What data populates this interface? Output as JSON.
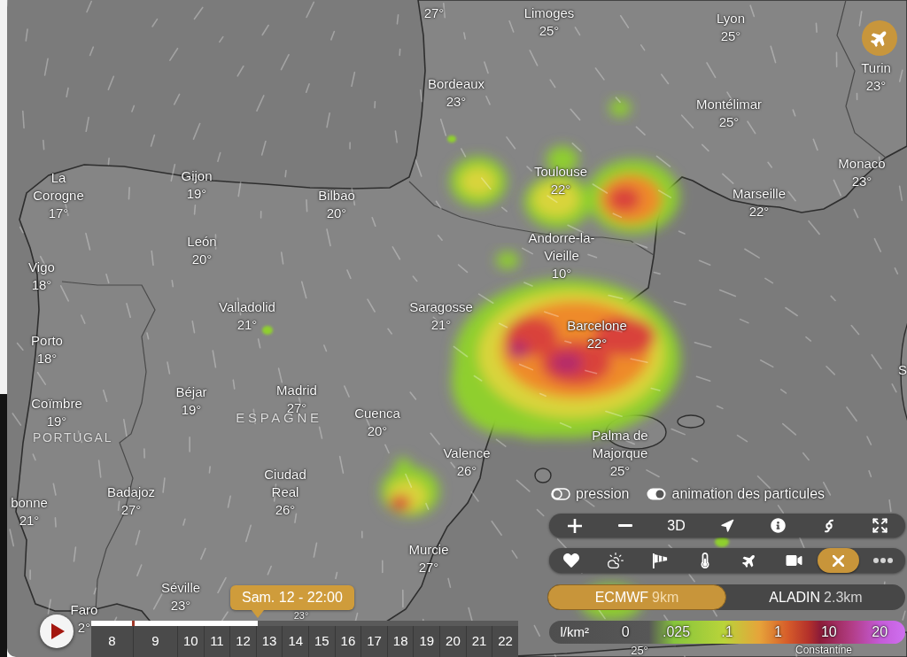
{
  "map": {
    "cities": [
      {
        "temp": "27°"
      },
      {
        "name": "Limoges",
        "temp": "25°"
      },
      {
        "name": "Lyon",
        "temp": "25°"
      },
      {
        "name": "Bordeaux",
        "temp": "23°"
      },
      {
        "name": "Turin",
        "temp": "23°"
      },
      {
        "name": "Montélimar",
        "temp": "25°"
      },
      {
        "name": "La Corogne",
        "temp": "17°"
      },
      {
        "name": "Gijon",
        "temp": "19°"
      },
      {
        "name": "Bilbao",
        "temp": "20°"
      },
      {
        "name": "Toulouse",
        "temp": "22°"
      },
      {
        "name": "Marseille",
        "temp": "22°"
      },
      {
        "name": "Monaco",
        "temp": "23°"
      },
      {
        "name": "Vigo",
        "temp": "18°"
      },
      {
        "name": "León",
        "temp": "20°"
      },
      {
        "name": "Andorre-la-Vieille",
        "temp": "10°"
      },
      {
        "name": "Porto",
        "temp": "18°"
      },
      {
        "name": "Valladolid",
        "temp": "21°"
      },
      {
        "name": "Saragosse",
        "temp": "21°"
      },
      {
        "name": "Barcelone",
        "temp": "22°"
      },
      {
        "name": "S"
      },
      {
        "name": "Coïmbre",
        "temp": "19°"
      },
      {
        "name": "Béjar",
        "temp": "19°"
      },
      {
        "name": "Madrid",
        "temp": "27°"
      },
      {
        "name": "Cuenca",
        "temp": "20°"
      },
      {
        "name": "bonne",
        "temp": "21°"
      },
      {
        "name": "Badajoz",
        "temp": "27°"
      },
      {
        "name": "Ciudad Real",
        "temp": "26°"
      },
      {
        "name": "Valence",
        "temp": "26°"
      },
      {
        "name": "Palma de Majorque",
        "temp": "25°"
      },
      {
        "name": "Murcie",
        "temp": "27°"
      },
      {
        "name": "Faro",
        "temp": "2°"
      },
      {
        "name": "Séville",
        "temp": "23°"
      },
      {
        "temp": "23°"
      },
      {
        "temp": "25°"
      },
      {
        "name": "Constantine"
      }
    ],
    "countries": [
      {
        "name": "ESPAGNE"
      },
      {
        "name": "PORTUGAL"
      }
    ]
  },
  "layer_toggles": [
    {
      "label": "pression",
      "on": false
    },
    {
      "label": "animation des particules",
      "on": true
    }
  ],
  "map_controls": [
    {
      "kind": "zoom_in"
    },
    {
      "kind": "zoom_out"
    },
    {
      "kind": "text",
      "label": "3D"
    },
    {
      "kind": "locate"
    },
    {
      "kind": "info"
    },
    {
      "kind": "hurricane"
    },
    {
      "kind": "fullscreen"
    }
  ],
  "layer_bar": [
    {
      "kind": "favorites"
    },
    {
      "kind": "clouds"
    },
    {
      "kind": "wind"
    },
    {
      "kind": "temperature"
    },
    {
      "kind": "airports"
    },
    {
      "kind": "webcams"
    },
    {
      "kind": "close"
    },
    {
      "kind": "more"
    }
  ],
  "models": [
    {
      "name": "ECMWF",
      "resolution": "9km",
      "selected": true
    },
    {
      "name": "ALADIN",
      "resolution": "2.3km",
      "selected": false
    }
  ],
  "legend": {
    "unit": "l/km²",
    "ticks": [
      "0",
      ".025",
      ".1",
      "1",
      "10",
      "20"
    ]
  },
  "timeline": {
    "tooltip": "Sam. 12 - 22:00",
    "level": 0.39,
    "days": [
      "8",
      "9",
      "10",
      "11",
      "12",
      "13",
      "14",
      "15",
      "16",
      "17",
      "18",
      "19",
      "20",
      "21",
      "22"
    ]
  }
}
